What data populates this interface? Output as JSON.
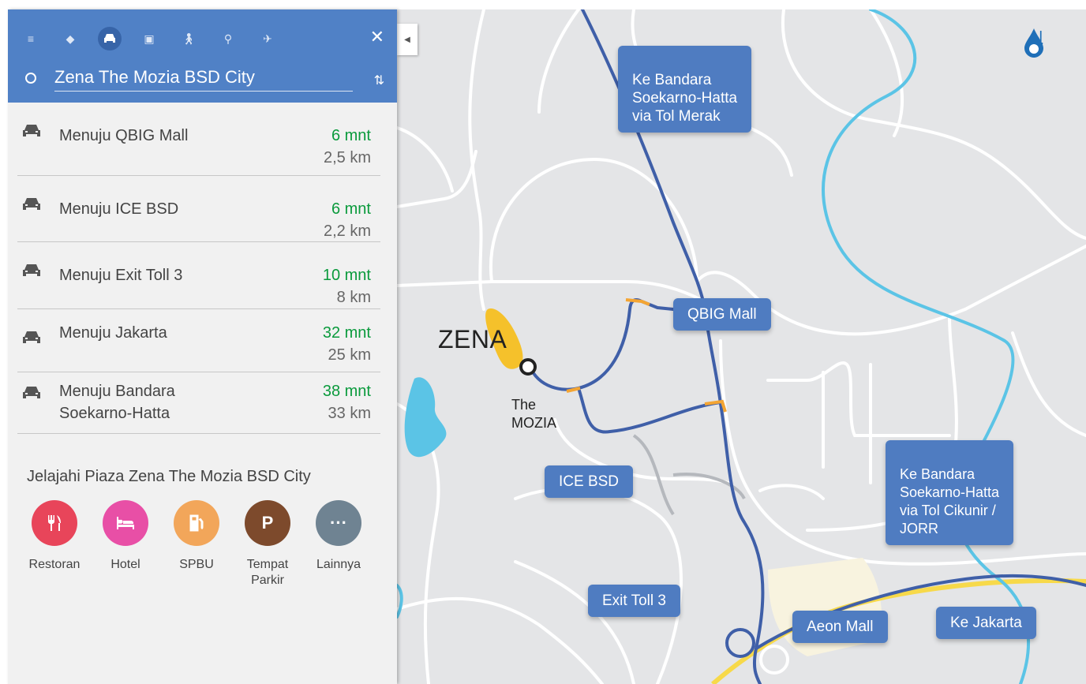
{
  "sidebar": {
    "origin": "Zena The Mozia BSD City",
    "routes": [
      {
        "name": "Menuju QBIG Mall",
        "time": "6 mnt",
        "distance": "2,5 km"
      },
      {
        "name": "Menuju ICE BSD",
        "time": "6 mnt",
        "distance": "2,2 km"
      },
      {
        "name": "Menuju Exit Toll 3",
        "time": "10 mnt",
        "distance": "8 km"
      },
      {
        "name": "Menuju Jakarta",
        "time": "32 mnt",
        "distance": "25 km"
      },
      {
        "name": "Menuju Bandara\nSoekarno-Hatta",
        "time": "38 mnt",
        "distance": "33 km"
      }
    ],
    "explore_title": "Jelajahi Piaza Zena The Mozia BSD City",
    "categories": [
      {
        "label": "Restoran",
        "icon": "restaurant-icon",
        "color": "#e8455a"
      },
      {
        "label": "Hotel",
        "icon": "hotel-icon",
        "color": "#e84fa6"
      },
      {
        "label": "SPBU",
        "icon": "gas-station-icon",
        "color": "#f2a65a"
      },
      {
        "label": "Tempat\nParkir",
        "icon": "parking-icon",
        "color": "#7d4a2c"
      },
      {
        "label": "Lainnya",
        "icon": "more-icon",
        "color": "#6f8392"
      }
    ],
    "modes": [
      "menu-icon",
      "directions-icon",
      "car-icon",
      "transit-icon",
      "walk-icon",
      "bike-icon",
      "flight-icon"
    ],
    "colors": {
      "header": "#5081c6",
      "time_green": "#0a9a3c",
      "route_blue": "#3f5fa8",
      "toll_cyan": "#5bc4e6"
    }
  },
  "map": {
    "compass_label": "N",
    "zena_label": "ZENA",
    "mozia_label": "The\nMOZIA",
    "callouts": {
      "airport_merak": "Ke Bandara\nSoekarno-Hatta\nvia Tol Merak",
      "qbig": "QBIG Mall",
      "ice": "ICE BSD",
      "airport_cikunir": "Ke Bandara\nSoekarno-Hatta\nvia Tol Cikunir /\nJORR",
      "exit_toll": "Exit Toll 3",
      "aeon": "Aeon Mall",
      "jakarta": "Ke Jakarta"
    }
  }
}
